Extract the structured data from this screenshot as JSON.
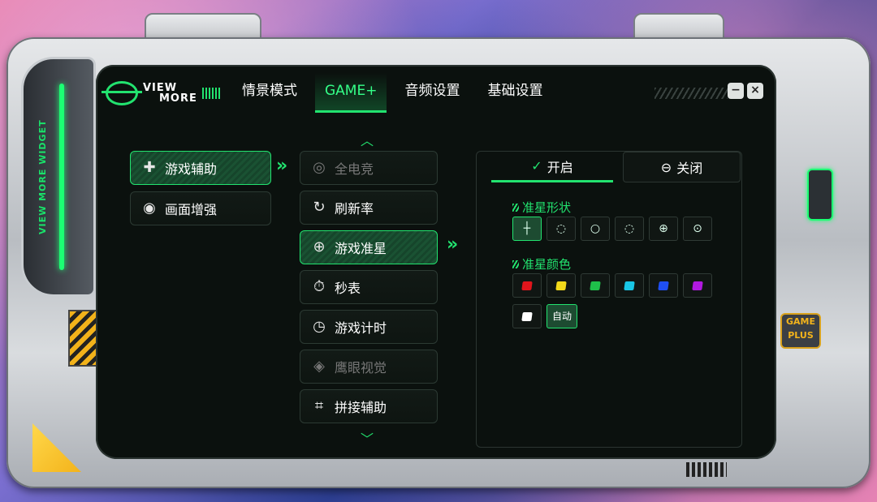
{
  "brand": {
    "logo_line1": "VIEW",
    "logo_line2": "MORE",
    "side_text": "VIEW MORE WIDGET",
    "badge_line1": "GAME",
    "badge_line2": "PLUS"
  },
  "nav": {
    "tabs": [
      "情景模式",
      "GAME+",
      "音频设置",
      "基础设置"
    ],
    "active_index": 1
  },
  "window": {
    "minimize": "−",
    "close": "×"
  },
  "left_menu": [
    {
      "label": "游戏辅助",
      "icon": "gamepad-icon",
      "selected": true
    },
    {
      "label": "画面增强",
      "icon": "eye-enhance-icon",
      "selected": false
    }
  ],
  "mid_menu": [
    {
      "label": "全电竞",
      "icon": "esports-icon",
      "dim": true
    },
    {
      "label": "刷新率",
      "icon": "refresh-rate-icon",
      "dim": false
    },
    {
      "label": "游戏准星",
      "icon": "crosshair-icon",
      "dim": false,
      "selected": true
    },
    {
      "label": "秒表",
      "icon": "stopwatch-icon",
      "dim": false
    },
    {
      "label": "游戏计时",
      "icon": "timer-icon",
      "dim": false
    },
    {
      "label": "鹰眼视觉",
      "icon": "hawk-eye-icon",
      "dim": true
    },
    {
      "label": "拼接辅助",
      "icon": "stitch-icon",
      "dim": false
    }
  ],
  "right_panel": {
    "on_label": "开启",
    "off_label": "关闭",
    "shape_title": "准星形状",
    "color_title": "准星颜色",
    "auto_label": "自动",
    "shapes": [
      "plus-crosshair-icon",
      "bracket-circle-icon",
      "dashed-circle-icon",
      "dotted-circle-icon",
      "target-circle-icon",
      "dot-circle-icon"
    ],
    "colors": [
      "#e0151c",
      "#f2d91a",
      "#1fbf4a",
      "#19c6e6",
      "#1f4ff2",
      "#b119e0",
      "#ffffff"
    ]
  }
}
